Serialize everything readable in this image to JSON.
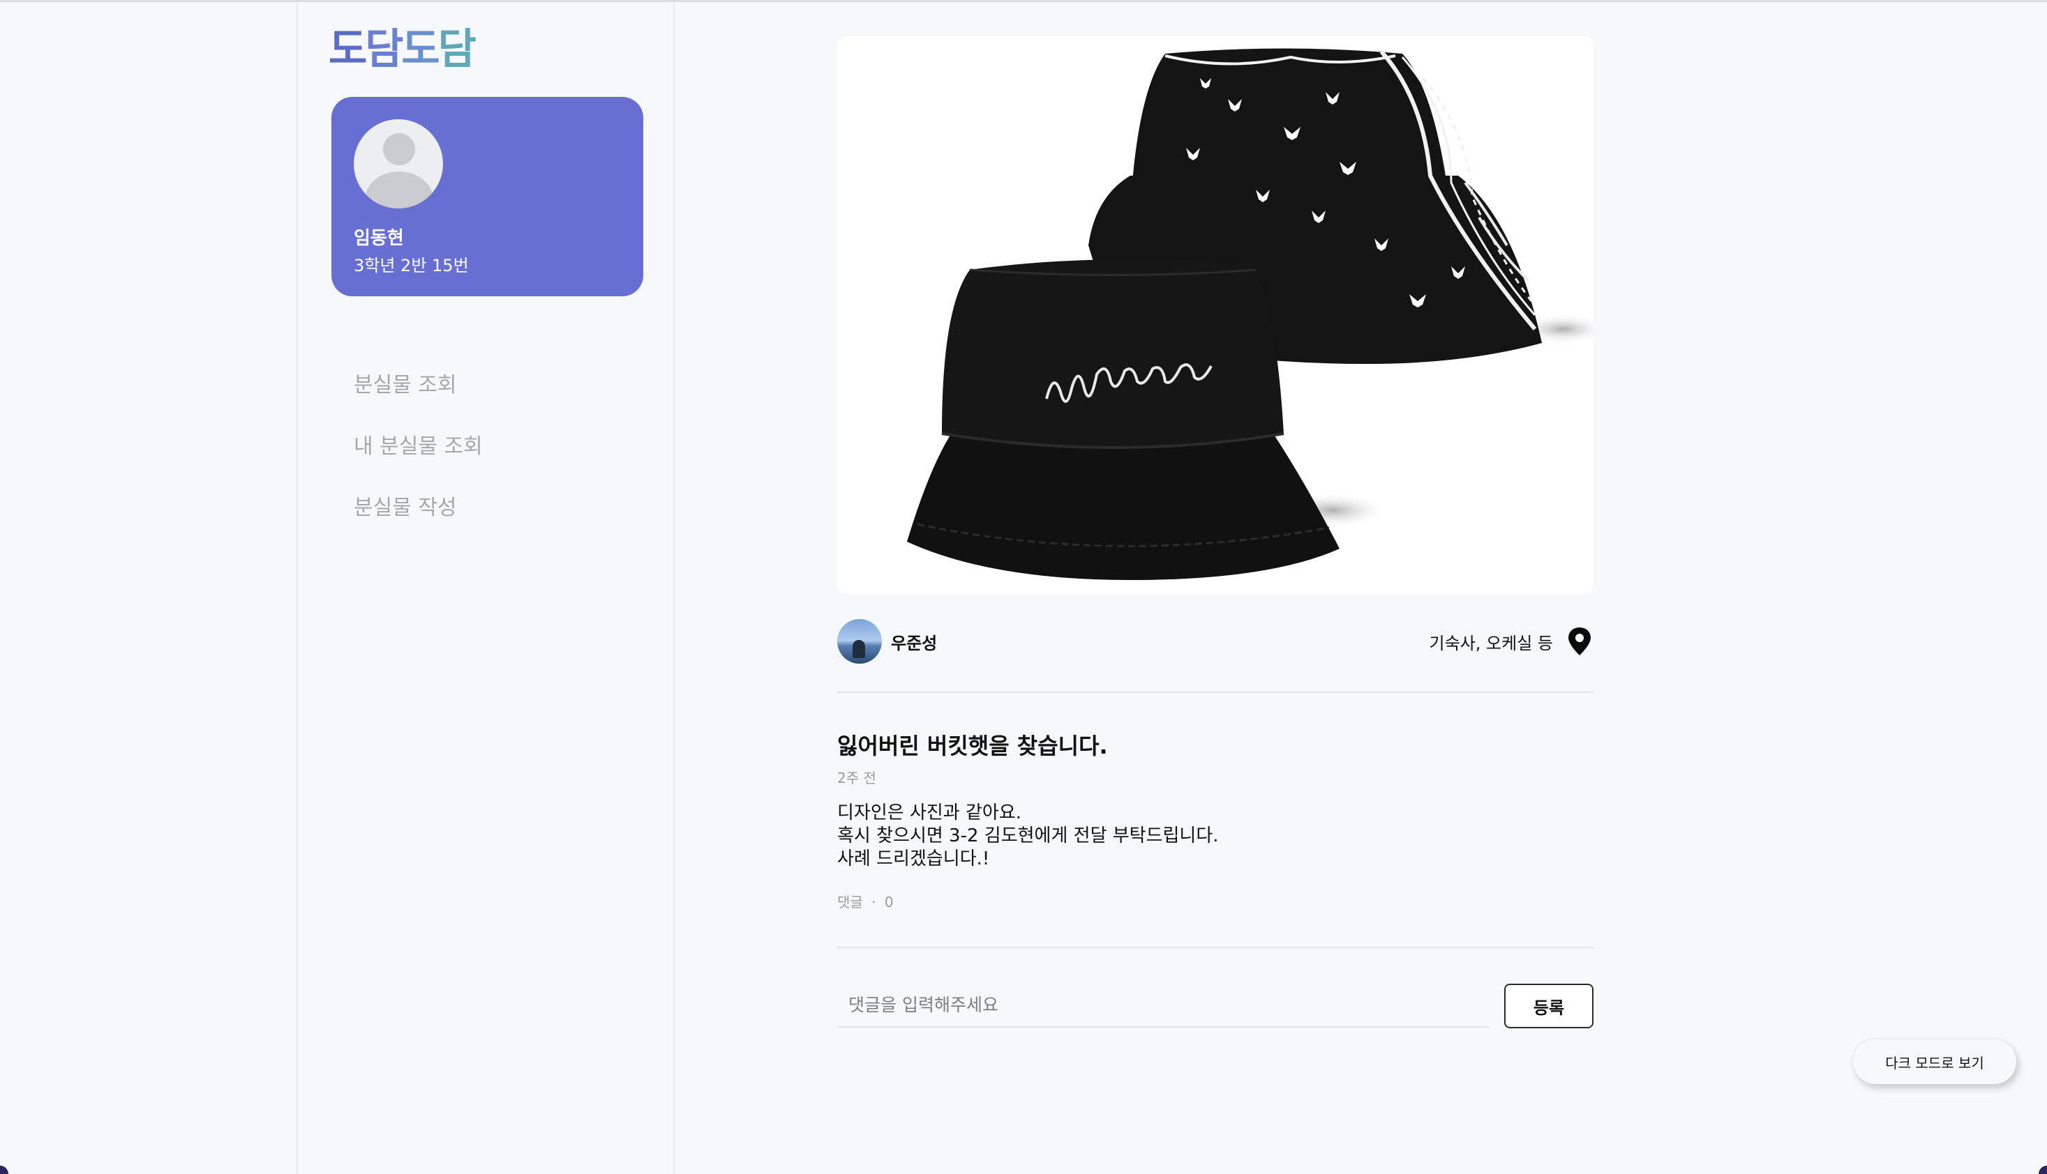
{
  "app": {
    "logo_text": "도담도담",
    "logo_colors": [
      "#5b6cc7",
      "#6a7fd0",
      "#6a8fcf",
      "#5fa7b9"
    ]
  },
  "profile": {
    "name": "임동현",
    "class_info": "3학년 2반 15번",
    "card_color": "#6770d2"
  },
  "nav": {
    "items": [
      {
        "label": "분실물 조회"
      },
      {
        "label": "내 분실물 조회"
      },
      {
        "label": "분실물 작성"
      }
    ]
  },
  "post": {
    "image_description_icon": "bucket-hats-photo",
    "author": "우준성",
    "location": "기숙사, 오케실 등",
    "title": "잃어버린 버킷햇을 찾습니다.",
    "time_ago": "2주 전",
    "body_lines": [
      "디자인은 사진과 같아요.",
      "혹시 찾으시면 3-2 김도현에게 전달 부탁드립니다.",
      "사례 드리겠습니다.!"
    ],
    "comment_label": "댓글",
    "comment_separator": "·",
    "comment_count": "0"
  },
  "comment_form": {
    "placeholder": "댓글을 입력해주세요",
    "value": "",
    "submit_label": "등록"
  },
  "dark_mode_button": "다크 모드로 보기"
}
